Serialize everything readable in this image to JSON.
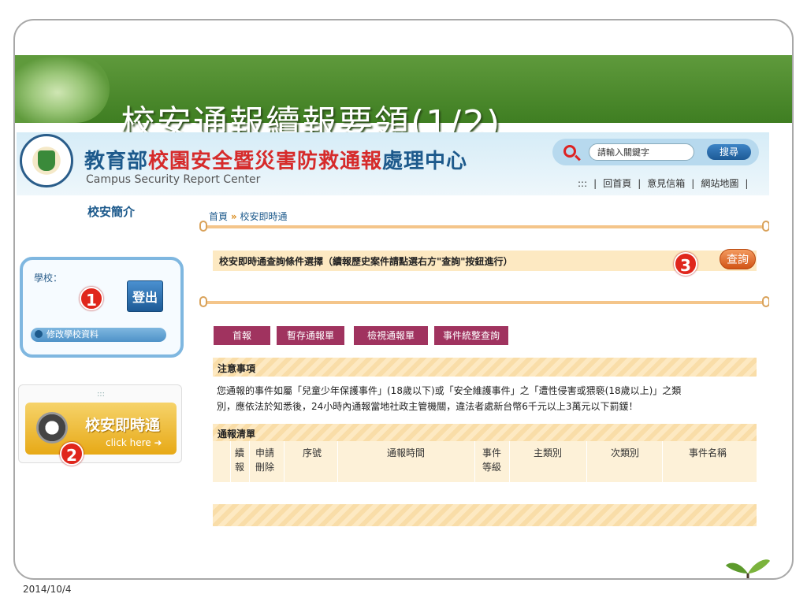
{
  "slide": {
    "title_part1": "校安通報",
    "title_part2": "續報",
    "title_part3": "要領(1/2)",
    "date": "2014/10/4"
  },
  "site": {
    "name_part1": "教育部",
    "name_part2": "校園安全暨災害防救通報",
    "name_part3": "處理中心",
    "subtitle": "Campus Security Report Center",
    "search_placeholder": "請輸入關鍵字",
    "search_button": "搜尋",
    "top_links": [
      ":::",
      "|",
      "回首頁",
      "|",
      "意見信箱",
      "|",
      "網站地圖",
      "|"
    ],
    "nav_about": "校安簡介"
  },
  "login": {
    "school_label": "學校：",
    "login_button": "登出",
    "edit_school": "修改學校資料"
  },
  "promo": {
    "dots": ":::",
    "title": "校安即時通",
    "click": "click here ➜"
  },
  "breadcrumb": {
    "home": "首頁",
    "sep": "»",
    "current": "校安即時通"
  },
  "query": {
    "text": "校安即時通查詢條件選擇（續報歷史案件請點選右方\"查詢\"按鈕進行）",
    "button": "查詢"
  },
  "tabs": [
    "首報",
    "暫存通報單",
    "檢視通報單",
    "事件統整查詢"
  ],
  "notice": {
    "title": "注意事項",
    "line1": "您通報的事件如屬「兒童少年保護事件」(18歲以下)或「安全維護事件」之「遭性侵害或猥褻(18歲以上)」之類",
    "line2": "別，應依法於知悉後，24小時內通報當地社政主管機關，違法者處新台幣6千元以上3萬元以下罰鍰！"
  },
  "list": {
    "title": "通報清單",
    "columns": [
      "續報",
      "申請刪除",
      "序號",
      "通報時間",
      "事件等級",
      "主類別",
      "次類別",
      "事件名稱"
    ],
    "col_lines": [
      [
        "續",
        "報"
      ],
      [
        "申請",
        "刪除"
      ],
      [
        "序號"
      ],
      [
        "通報時間"
      ],
      [
        "事件",
        "等級"
      ],
      [
        "主類別"
      ],
      [
        "次類別"
      ],
      [
        "事件名稱"
      ]
    ]
  },
  "markers": [
    "1",
    "2",
    "3"
  ],
  "colors": {
    "banner_green": "#3f7e22",
    "brand_blue": "#1d5a8c",
    "brand_red": "#d62b2b",
    "tab_magenta": "#a0335f",
    "marker_red": "#e0261c",
    "panel_tan": "#fde9c2"
  }
}
